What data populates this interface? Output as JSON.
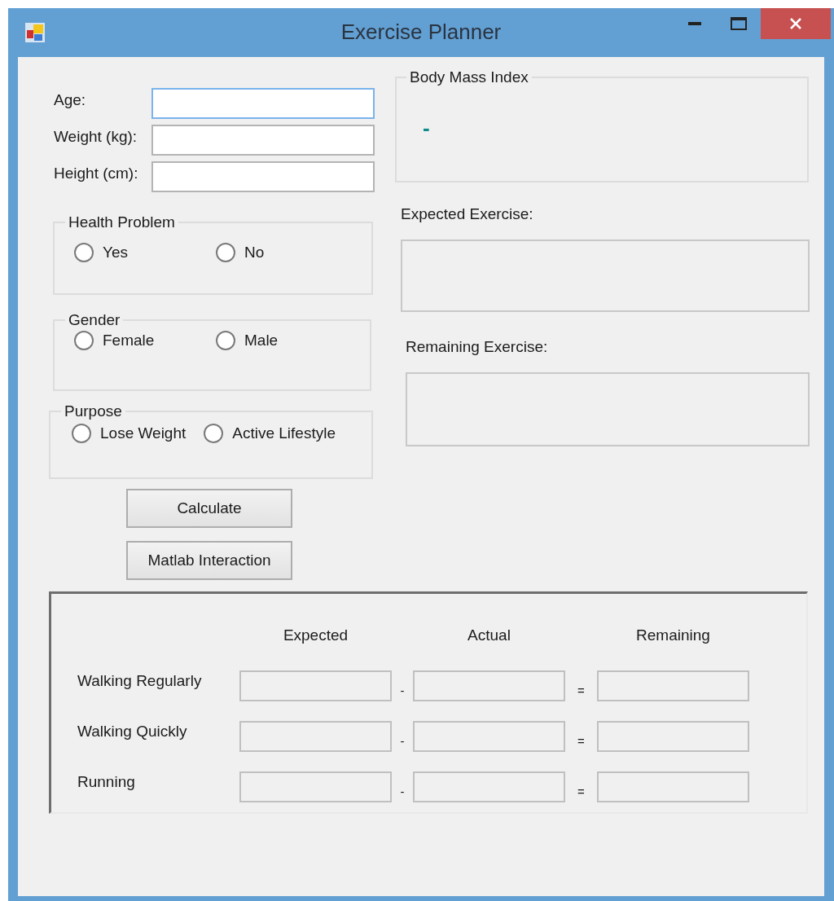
{
  "window": {
    "title": "Exercise Planner"
  },
  "fields": [
    {
      "label": "Age:",
      "focused": true
    },
    {
      "label": "Weight (kg):",
      "focused": false
    },
    {
      "label": "Height (cm):",
      "focused": false
    }
  ],
  "groups": [
    {
      "title": "Health Problem",
      "options": [
        {
          "label": "Yes",
          "selected": false
        },
        {
          "label": "No",
          "selected": false
        }
      ]
    },
    {
      "title": "Gender",
      "options": [
        {
          "label": "Female",
          "selected": false
        },
        {
          "label": "Male",
          "selected": false
        }
      ]
    },
    {
      "title": "Purpose",
      "options": [
        {
          "label": "Lose Weight",
          "selected": false
        },
        {
          "label": "Active Lifestyle",
          "selected": false
        }
      ]
    }
  ],
  "buttons": [
    "Calculate",
    "Matlab Interaction"
  ],
  "bmi": {
    "title": "Body Mass Index",
    "value": "-"
  },
  "expected": {
    "label": "Expected Exercise:"
  },
  "remaining": {
    "label": "Remaining Exercise:"
  },
  "grid": {
    "columns": [
      "Expected",
      "Actual",
      "Remaining"
    ],
    "rows": [
      {
        "label": "Walking Regularly",
        "minus": "-",
        "equals": "="
      },
      {
        "label": "Walking Quickly",
        "minus": "-",
        "equals": "="
      },
      {
        "label": "Running",
        "minus": "-",
        "equals": "="
      }
    ]
  }
}
